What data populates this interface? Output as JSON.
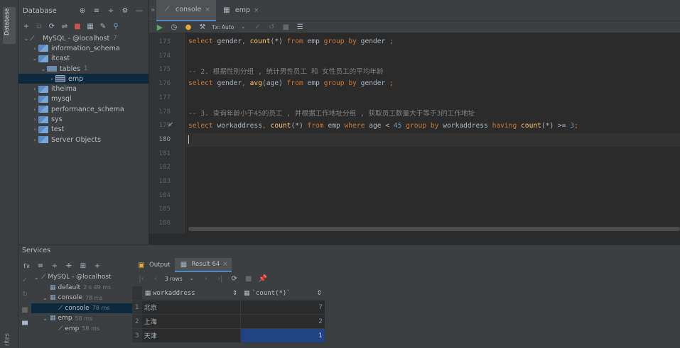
{
  "left_strip": {
    "db_tab": "Database",
    "bottom_tab": "rites"
  },
  "db_panel": {
    "title": "Database",
    "tree": [
      {
        "label": "MySQL - @localhost",
        "count": "7",
        "indent": 0,
        "type": "conn",
        "arrow": "⌄"
      },
      {
        "label": "information_schema",
        "indent": 1,
        "type": "db",
        "arrow": "›"
      },
      {
        "label": "itcast",
        "indent": 1,
        "type": "db",
        "arrow": "⌄"
      },
      {
        "label": "tables",
        "count": "1",
        "indent": 2,
        "type": "folder",
        "arrow": "⌄"
      },
      {
        "label": "emp",
        "indent": 3,
        "type": "table",
        "arrow": "›",
        "selected": true
      },
      {
        "label": "itheima",
        "indent": 1,
        "type": "db",
        "arrow": "›"
      },
      {
        "label": "mysql",
        "indent": 1,
        "type": "db",
        "arrow": "›"
      },
      {
        "label": "performance_schema",
        "indent": 1,
        "type": "db",
        "arrow": "›"
      },
      {
        "label": "sys",
        "indent": 1,
        "type": "db",
        "arrow": "›"
      },
      {
        "label": "test",
        "indent": 1,
        "type": "db",
        "arrow": "›"
      },
      {
        "label": "Server Objects",
        "indent": 1,
        "type": "db",
        "arrow": "›"
      }
    ]
  },
  "editor_tabs": [
    {
      "label": "console",
      "active": true
    },
    {
      "label": "emp",
      "active": false
    }
  ],
  "editor_toolbar": {
    "tx_mode": "Tx: Auto"
  },
  "editor": {
    "lines": [
      {
        "n": "173"
      },
      {
        "n": "174"
      },
      {
        "n": "175"
      },
      {
        "n": "176"
      },
      {
        "n": "177"
      },
      {
        "n": "178"
      },
      {
        "n": "179"
      },
      {
        "n": "180"
      },
      {
        "n": "181"
      },
      {
        "n": "182"
      },
      {
        "n": "183"
      },
      {
        "n": "184"
      },
      {
        "n": "185"
      },
      {
        "n": "186"
      }
    ],
    "code": {
      "l173": "select gender, count(*) from emp group by gender ;",
      "l175": "-- 2. 根据性别分组 , 统计男性员工 和 女性员工的平均年龄",
      "l176": "select gender, avg(age) from emp group by gender ;",
      "l178": "-- 3. 查询年龄小于45的员工 , 并根据工作地址分组 , 获取员工数量大于等于3的工作地址",
      "l179": "select workaddress, count(*) from emp where age < 45 group by workaddress having count(*) >= 3;"
    }
  },
  "services": {
    "title": "Services",
    "tree": [
      {
        "label": "MySQL - @localhost",
        "time": "",
        "indent": 0
      },
      {
        "label": "default",
        "time": "2 s 49 ms",
        "indent": 1
      },
      {
        "label": "console",
        "time": "78 ms",
        "indent": 1
      },
      {
        "label": "console",
        "time": "78 ms",
        "indent": 2,
        "selected": true
      },
      {
        "label": "emp",
        "time": "58 ms",
        "indent": 1
      },
      {
        "label": "emp",
        "time": "58 ms",
        "indent": 2
      }
    ],
    "result_tabs": [
      {
        "label": "Output",
        "active": false
      },
      {
        "label": "Result 64",
        "active": true
      }
    ],
    "rows_label": "3 rows",
    "columns": [
      "workaddress",
      "`count(*)`"
    ],
    "rows": [
      {
        "n": "1",
        "a": "北京",
        "b": "7"
      },
      {
        "n": "2",
        "a": "上海",
        "b": "2"
      },
      {
        "n": "3",
        "a": "天津",
        "b": "1"
      }
    ]
  }
}
